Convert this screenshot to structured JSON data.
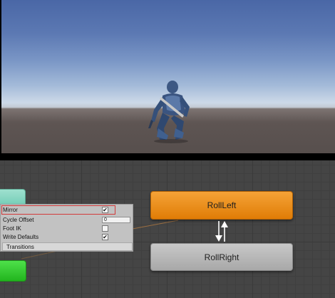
{
  "inspector": {
    "mirror": {
      "label": "Mirror",
      "checked": true
    },
    "cycle_offset": {
      "label": "Cycle Offset",
      "value": "0"
    },
    "foot_ik": {
      "label": "Foot IK",
      "checked": false
    },
    "write_defaults": {
      "label": "Write Defaults",
      "checked": true
    },
    "transitions_label": "Transitions"
  },
  "graph": {
    "states": {
      "roll_left": "RollLeft",
      "roll_right": "RollRight"
    }
  },
  "colors": {
    "active_state": "#e88a10",
    "entry_state": "#6ccab2",
    "any_state": "#22b51e",
    "highlight": "#d23a3a"
  },
  "icons": {
    "checked": "✔",
    "unchecked": ""
  }
}
